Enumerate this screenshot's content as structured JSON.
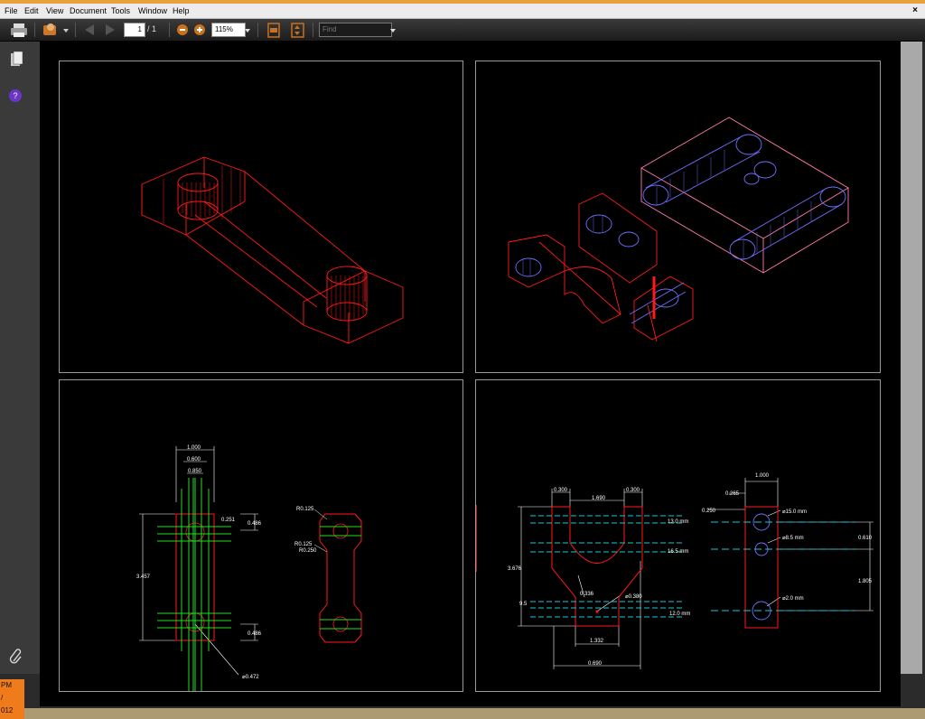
{
  "menubar": {
    "items": [
      "File",
      "Edit",
      "View",
      "Document",
      "Tools",
      "Window",
      "Help"
    ],
    "close_label": "×"
  },
  "toolbar": {
    "page_current": "1",
    "page_total": "/ 1",
    "zoom": "115%",
    "find_placeholder": "Find"
  },
  "clock": {
    "line1": "PM",
    "line2": "/",
    "line3": "012"
  },
  "drawing": {
    "left_dims": {
      "w1": "1.000",
      "w2": "0.600",
      "w3": "0.850",
      "r1": "0.251",
      "r2": "0.486",
      "r3": "0.486",
      "h": "3.457",
      "hole": "⌀0.472"
    },
    "side_dims": {
      "r1": "R0.125",
      "r2": "R0.125",
      "r3": "R0.250"
    },
    "right_dims": {
      "a": "0.300",
      "b": "1.690",
      "c": "0.300",
      "h": "3.676",
      "d1": "13.0 mm",
      "d2": "16.5 mm",
      "d3": "12.0 mm",
      "e": "0.336",
      "f": "⌀0.380",
      "g": "9.5",
      "k": "1.332",
      "m": "0.690"
    },
    "far_dims": {
      "w": "1.000",
      "a": "0.265",
      "b": "0.250",
      "c1": "⌀15.0 mm",
      "c2": "⌀8.5 mm",
      "c3": "⌀2.0 mm",
      "v1": "0.610",
      "v2": "1.805"
    }
  },
  "colors": {
    "wire_red": "#ff1a1a",
    "wire_blue": "#6f6fff",
    "wire_pink": "#ff7ab0",
    "green": "#22dd22",
    "cyan": "#18c8d8"
  }
}
